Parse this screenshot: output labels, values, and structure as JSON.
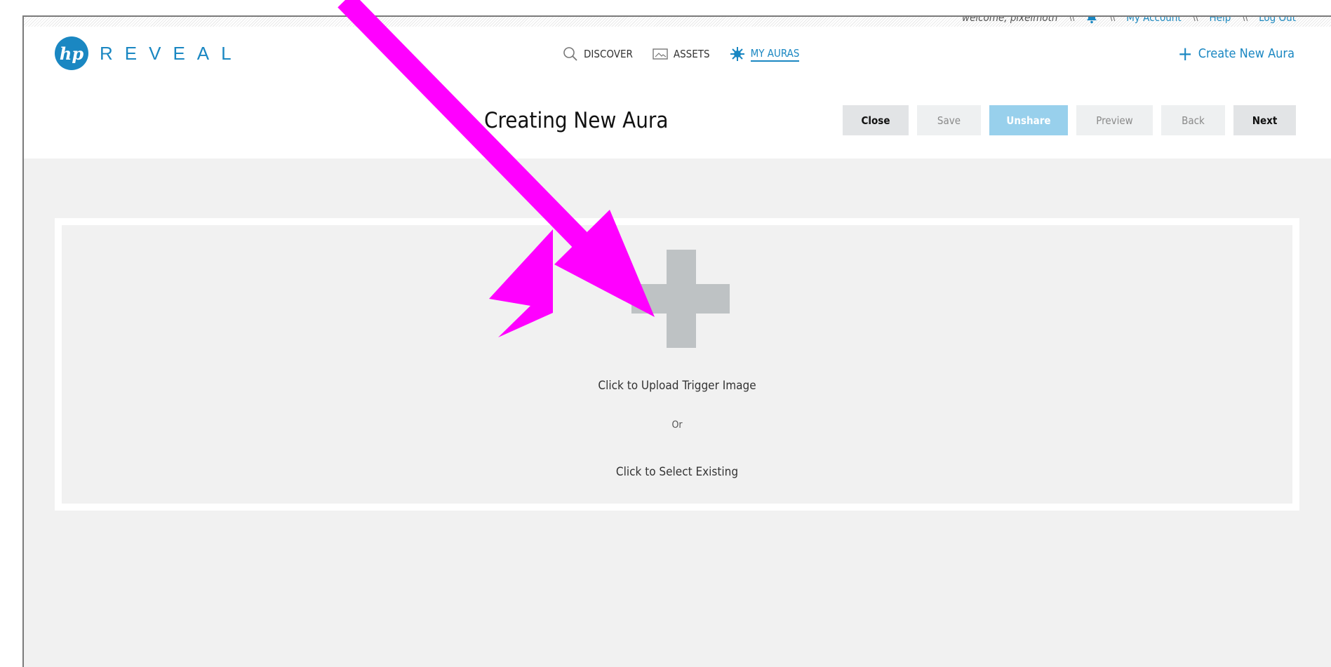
{
  "topbar": {
    "welcome": "welcome, pixelmoth",
    "separator": "\\\\",
    "my_account": "My Account",
    "help": "Help",
    "logout": "Log Out"
  },
  "logo": {
    "mark": "hp",
    "text": "REVEAL"
  },
  "nav": {
    "discover": "DISCOVER",
    "assets": "ASSETS",
    "my_auras": "MY AURAS"
  },
  "create_new": "Create New Aura",
  "page_title": "Creating New Aura",
  "actions": {
    "close": "Close",
    "save": "Save",
    "unshare": "Unshare",
    "preview": "Preview",
    "back": "Back",
    "next": "Next"
  },
  "upload": {
    "upload_label": "Click to Upload Trigger Image",
    "or_label": "Or",
    "select_label": "Click to Select Existing"
  },
  "colors": {
    "accent": "#1a87c2",
    "unshare_button": "#98d0ec",
    "content_bg": "#f1f1f1",
    "annotation_arrow": "#ff00ff"
  },
  "icons": [
    "bell-icon",
    "search-icon",
    "image-icon",
    "aura-burst-icon",
    "plus-icon"
  ]
}
